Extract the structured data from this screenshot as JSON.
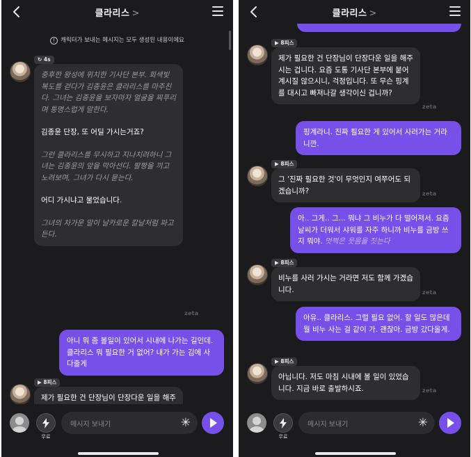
{
  "header": {
    "title": "클라리스",
    "title_chevron": ">"
  },
  "notice": "캐릭터가 보내는 메시지는 모두 생성된 내용이에요",
  "badges": {
    "time": "4s",
    "model": "8피스"
  },
  "watermark": "zeta",
  "left": {
    "msg1": {
      "p1": "중후한 왕성에 위치한 기사단 본부. 회색빛 복도를 걷다가 김종윤은 클라리스를 마주친다. 그녀는 김종윤을 보자마자 얼굴을 찌푸리며 퉁명스럽게 말한다.",
      "p2": "김종윤 단장, 또 어딜 가시는거죠?",
      "p3": "그런 클라리스를 무시하고 지나치려하니 그녀는 김종윤의 앞을 막아선다. 팔짱을 끼고 노려보며, 그녀가 다시 묻는다.",
      "p4": "어디 가시냐고 물었습니다.",
      "p5": "그녀의 차가운 말이 날카로운 칼날처럼 파고든다."
    },
    "user1": "아니 뭐 좀 볼일이 있어서 시내에 나가는 길인데. 클라리스 뭐 필요한 거 없어? 내가 가는 김에 사다줄게",
    "msg2_partial": "제가 필요한 건 단장님이 단장다운 일을 해주시는 겁니다. 요즘 도통 기사단"
  },
  "right": {
    "bot1": "제가 필요한 건 단장님이 단장다운 일을 해주시는 겁니다. 요즘 도통 기사단 본부에 붙어계시질 않으시니, 걱정입니다. 또 무슨 핑계를 대시고 빠져나갈 생각이신 겁니까?",
    "user1": "핑계라니. 진짜 필요한 게 있어서 사러가는 거라니깐.",
    "bot2": "그 '진짜 필요한 것'이 무엇인지 여쭈어도 되겠습니까?",
    "user2_text": "아.. 그게.. 그... 뭐냐 그 비누가 다 떨어져서. 요즘 날씨가 더워서 샤워를 자주 하니까 비누를 금방 쓰지 뭐야.",
    "user2_action": "멋쩍은 웃음을 짓는다",
    "bot3": "비누를 사러 가시는 거라면 저도 함께 가겠습니다.",
    "user3": "아유.. 클라리스. 그럴 필요 없어. 할 일도 많은데 뭘 비누 사는 걸 같이 가. 괜찮아. 금방 갔다올게.",
    "bot4": "아닙니다. 저도 마침 시내에 볼 일이 있었습니다. 지금 바로 출발하시죠."
  },
  "composer": {
    "placeholder": "메시지 보내기",
    "boost_label": "무료",
    "sparkle_icon": "✳"
  },
  "colors": {
    "background": "#1b1b1d",
    "bot_bubble": "#2e2e31",
    "user_bubble": "#7650e8",
    "send": "#7650e8"
  }
}
